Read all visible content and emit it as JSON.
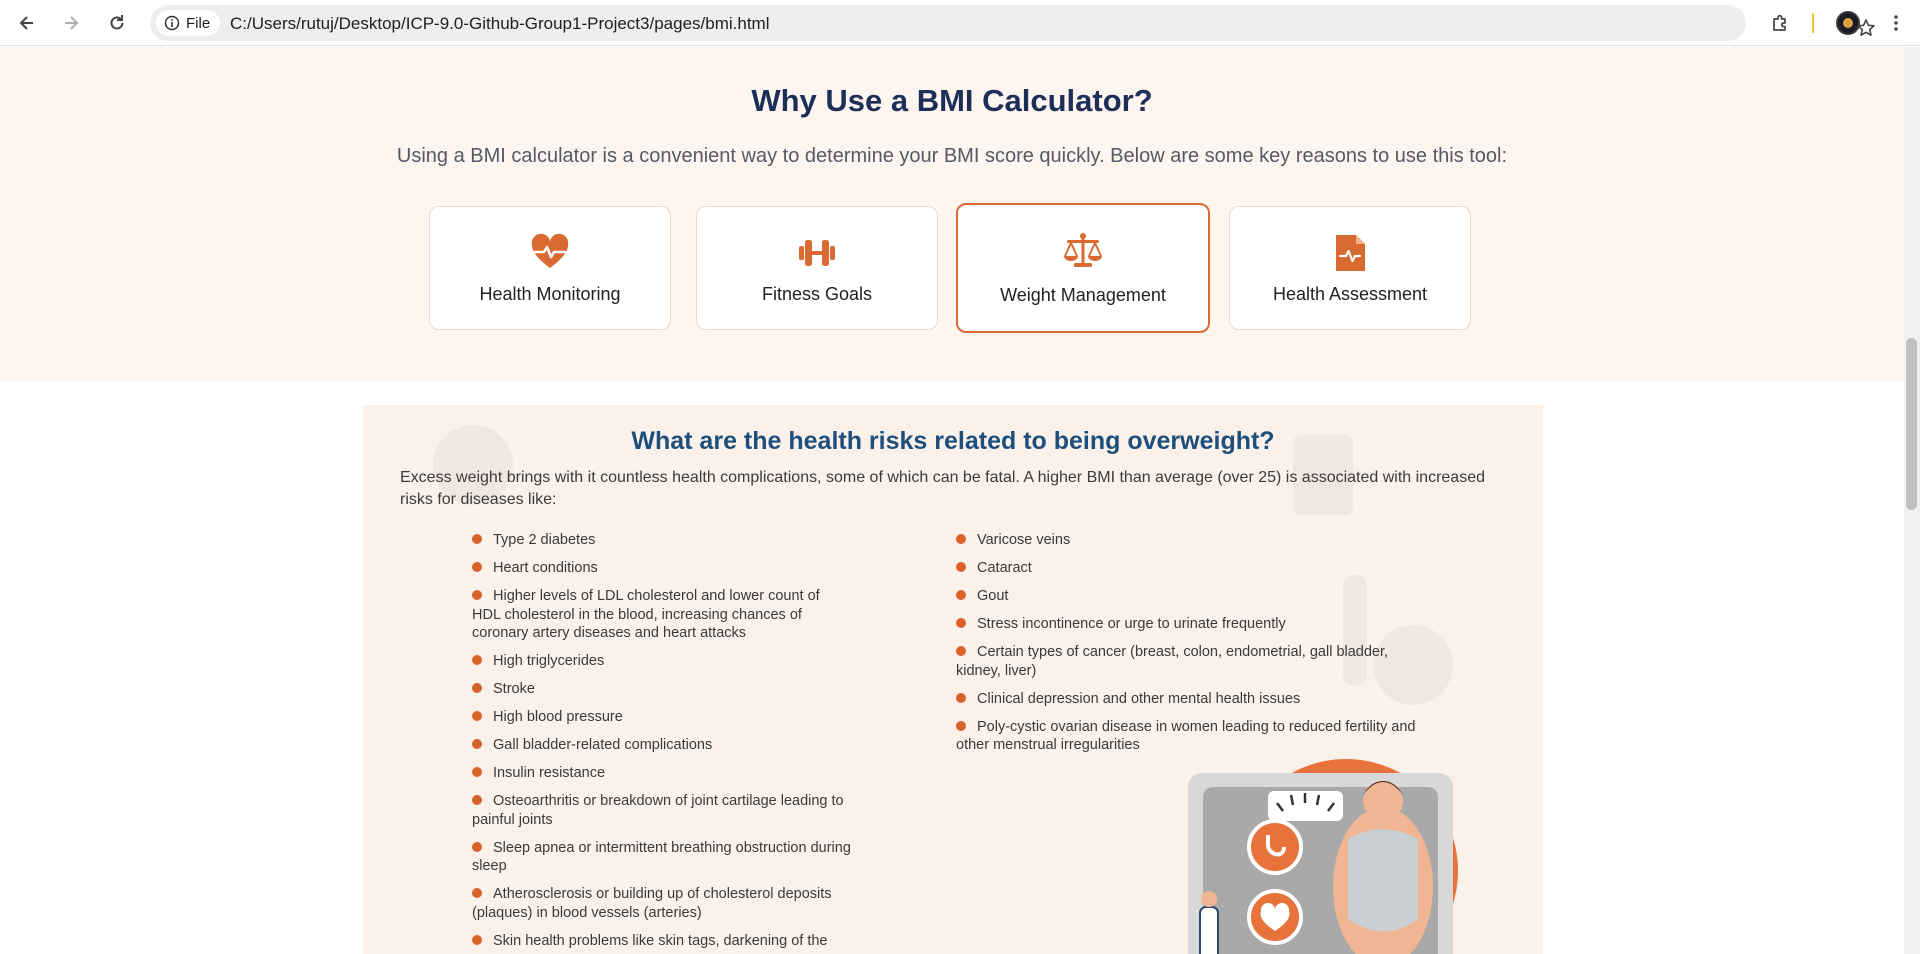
{
  "browser": {
    "scheme_label": "File",
    "url": "C:/Users/rutuj/Desktop/ICP-9.0-Github-Group1-Project3/pages/bmi.html"
  },
  "why_section": {
    "title": "Why Use a BMI Calculator?",
    "subtitle": "Using a BMI calculator is a convenient way to determine your BMI score quickly. Below are some key reasons to use this tool:",
    "cards": [
      {
        "label": "Health Monitoring",
        "icon": "heart-pulse-icon",
        "active": false
      },
      {
        "label": "Fitness Goals",
        "icon": "dumbbell-icon",
        "active": false
      },
      {
        "label": "Weight Management",
        "icon": "scale-balance-icon",
        "active": true
      },
      {
        "label": "Health Assessment",
        "icon": "medical-file-icon",
        "active": false
      }
    ]
  },
  "risks_section": {
    "title": "What are the health risks related to being overweight?",
    "intro": "Excess weight brings with it countless health complications, some of which can be fatal. A higher BMI than average (over 25) is associated with increased risks for diseases like:",
    "left_list": [
      "Type 2 diabetes",
      "Heart conditions",
      "Higher levels of LDL cholesterol and lower count of HDL cholesterol in the blood, increasing chances of coronary artery diseases and heart attacks",
      "High triglycerides",
      "Stroke",
      "High blood pressure",
      "Gall bladder-related complications",
      "Insulin resistance",
      "Osteoarthritis or breakdown of joint cartilage leading to painful joints",
      "Sleep apnea or intermittent breathing obstruction during sleep",
      "Atherosclerosis or building up of cholesterol deposits (plaques) in blood vessels (arteries)",
      "Skin health problems like skin tags, darkening of the"
    ],
    "right_list": [
      "Varicose veins",
      "Cataract",
      "Gout",
      "Stress incontinence or urge to urinate frequently",
      "Certain types of cancer (breast, colon, endometrial, gall bladder, kidney, liver)",
      "Clinical depression and other mental health issues",
      "Poly-cystic ovarian disease in women leading to reduced fertility and other menstrual irregularities"
    ]
  },
  "colors": {
    "accent": "#d86a32",
    "title_navy": "#1d2f57",
    "risk_title_blue": "#1e4f7c",
    "bullet": "#d9622b"
  }
}
